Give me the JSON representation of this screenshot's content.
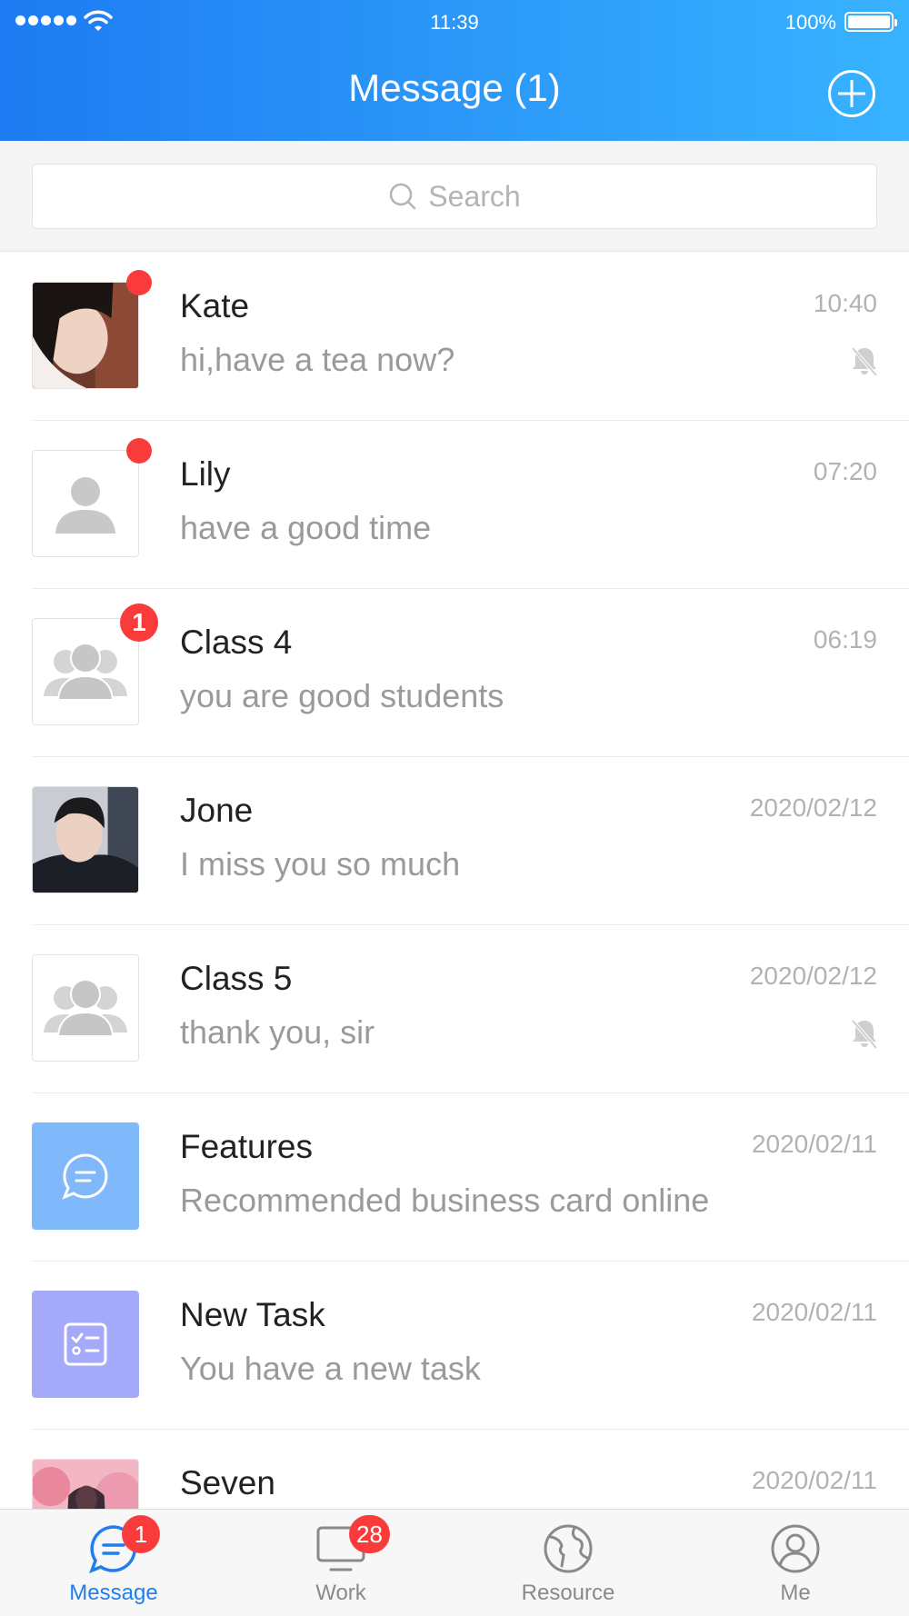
{
  "status_bar": {
    "time": "11:39",
    "battery": "100%"
  },
  "header": {
    "title": "Message (1)"
  },
  "search": {
    "placeholder": "Search"
  },
  "conversations": [
    {
      "name": "Kate",
      "message": "hi,have a tea now?",
      "time": "10:40",
      "avatar": "photo-kate",
      "unread_dot": true,
      "muted": true
    },
    {
      "name": "Lily",
      "message": "have a good time",
      "time": "07:20",
      "avatar": "person-placeholder-icon",
      "unread_dot": true,
      "muted": false
    },
    {
      "name": "Class 4",
      "message": "you are good students",
      "time": "06:19",
      "avatar": "group-icon",
      "unread_count": "1",
      "muted": false
    },
    {
      "name": "Jone",
      "message": "I miss you so much",
      "time": "2020/02/12",
      "avatar": "photo-jone",
      "muted": false
    },
    {
      "name": "Class 5",
      "message": "thank you, sir",
      "time": "2020/02/12",
      "avatar": "group-icon",
      "muted": true
    },
    {
      "name": "Features",
      "message": "Recommended business card online",
      "time": "2020/02/11",
      "avatar": "chat-bubble-icon",
      "avatar_color": "#7fb8fb",
      "muted": false
    },
    {
      "name": "New Task",
      "message": "You have a new task",
      "time": "2020/02/11",
      "avatar": "task-list-icon",
      "avatar_color": "#a5a9f9",
      "muted": false
    },
    {
      "name": "Seven",
      "message": "",
      "time": "2020/02/11",
      "avatar": "photo-seven",
      "muted": false
    }
  ],
  "tabs": [
    {
      "label": "Message",
      "icon": "message-icon",
      "badge": "1",
      "active": true
    },
    {
      "label": "Work",
      "icon": "monitor-icon",
      "badge": "28",
      "active": false
    },
    {
      "label": "Resource",
      "icon": "globe-icon",
      "badge": "",
      "active": false
    },
    {
      "label": "Me",
      "icon": "user-icon",
      "badge": "",
      "active": false
    }
  ],
  "colors": {
    "header_start": "#1e7bf2",
    "header_end": "#38b3ff",
    "badge": "#fa3b3b",
    "active_tab": "#1f7fef"
  }
}
